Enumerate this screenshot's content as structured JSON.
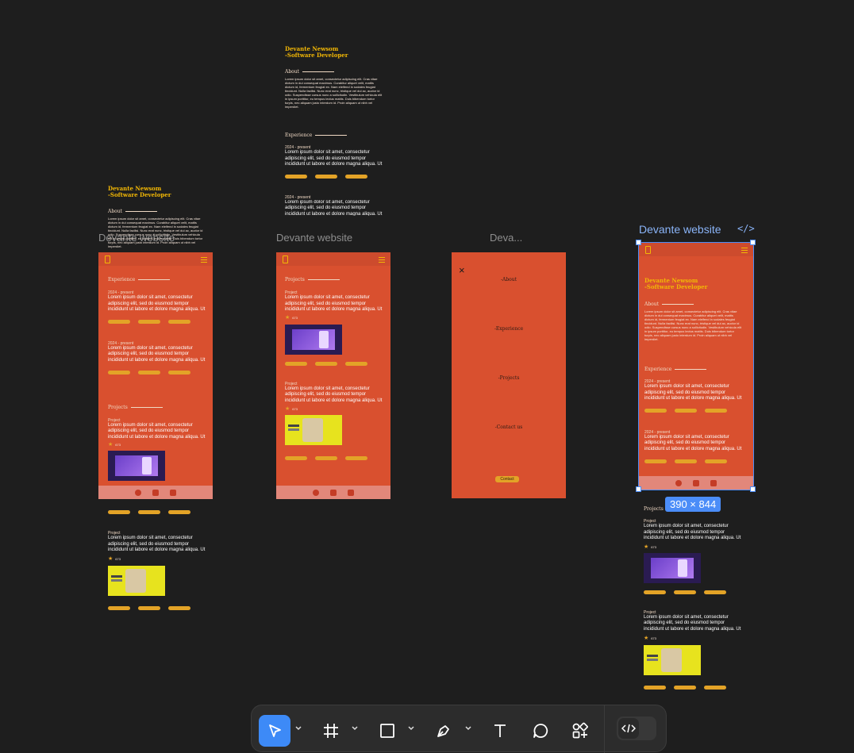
{
  "frames": [
    {
      "label": "Devante website"
    },
    {
      "label": "Devante website"
    },
    {
      "label": "Deva..."
    },
    {
      "label": "Devante website"
    }
  ],
  "selection": {
    "dimensions": "390 × 844"
  },
  "portfolio": {
    "name_line1": "Devante Newsom",
    "name_line2": "-Software Developer",
    "about_title": "About",
    "about_text": "Lorem ipsum dolor sit amet, consectetur adipiscing elit. Cras vitae dictum in dui consequat maximus. Curabitur aliquet velit, mattis dictum id, fermentum feugiat ex. Nam eleifend in sodales feugiat tincidunt. Nulla facilisi. Nunc erat nunc, tristique vel dui ac, auctor id odio. Suspendisse cursus nunc a sollicitudin. Vestibulum vehicula elit in ipsum porttitor, eu tempus lectus mattis. Duis bibendum tortor turpis, nec aliquam justo interdum id. Proin aliquam ut nibh vel imperdiet.",
    "experience_title": "Experience",
    "projects_title": "Projects",
    "role": "2024 - present",
    "body": "Lorem ipsum dolor sit amet, consectetur adipiscing elit, sed do eiusmod tempor incididunt ut labore et dolore magna aliqua. Ut",
    "project_label": "Project",
    "stars": "673"
  },
  "menu": {
    "items": [
      "-About",
      "-Experience",
      "-Projects",
      "-Contact us"
    ],
    "close": "×",
    "button": "Contact"
  },
  "toolbar": {
    "tools": [
      "move-tool",
      "frame-tool",
      "rectangle-tool",
      "pen-tool",
      "text-tool",
      "comment-tool",
      "actions-tool",
      "dev-mode-toggle"
    ]
  }
}
